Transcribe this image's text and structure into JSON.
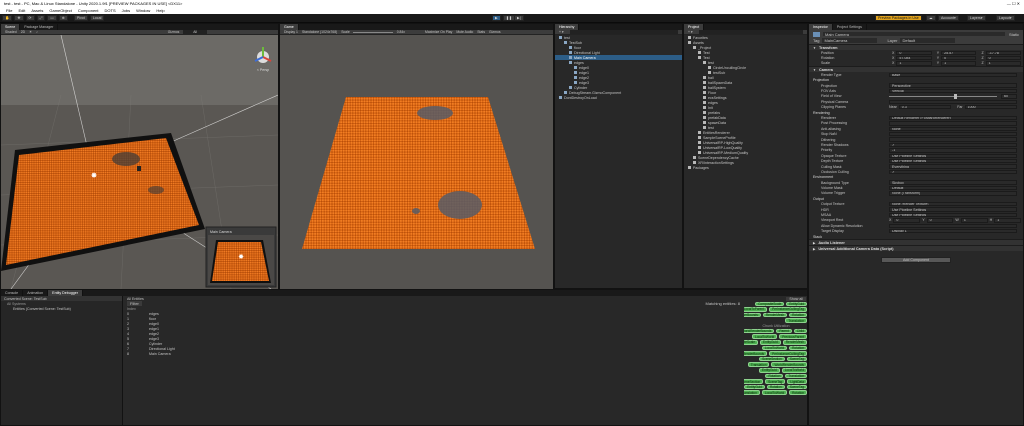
{
  "title_bar": "test - test - PC, Mac & Linux Standalone - Unity 2020.1.9f1 [PREVIEW PACKAGES IN USE] <DX11>",
  "menu": [
    "File",
    "Edit",
    "Assets",
    "GameObject",
    "Component",
    "DOTS",
    "Jobs",
    "Window",
    "Help"
  ],
  "toolbar": {
    "pivot": "Pivot",
    "local": "Local",
    "preview_packages": "Preview Packages in Use",
    "account": "Account",
    "layers": "Layers",
    "layout": "Layout"
  },
  "scene_view": {
    "tabs": [
      "Scene",
      "Package Manager"
    ],
    "shading": "Shaded",
    "mode_2d": "2D",
    "gizmos": "Gizmos",
    "search_placeholder": "All",
    "persp": "< Persp",
    "cam_preview_title": "Main Camera"
  },
  "game_view": {
    "tab": "Game",
    "display": "Display 1",
    "resolution": "Standalone (1024x768)",
    "scale_label": "Scale",
    "scale_value": "0.84x",
    "maximize": "Maximize On Play",
    "mute": "Mute Audio",
    "stats": "Stats",
    "gizmos": "Gizmos"
  },
  "hierarchy": {
    "tab": "Hierarchy",
    "items": [
      {
        "label": "test",
        "depth": 0
      },
      {
        "label": "TestSub",
        "depth": 1
      },
      {
        "label": "floor",
        "depth": 2
      },
      {
        "label": "Directional Light",
        "depth": 2
      },
      {
        "label": "Main Camera",
        "depth": 2,
        "selected": true
      },
      {
        "label": "edges",
        "depth": 2
      },
      {
        "label": "edge0",
        "depth": 3
      },
      {
        "label": "edge1",
        "depth": 3
      },
      {
        "label": "edge2",
        "depth": 3
      },
      {
        "label": "edge3",
        "depth": 3
      },
      {
        "label": "Cylinder",
        "depth": 2
      },
      {
        "label": "DebugStream.GizmoComponent",
        "depth": 1
      },
      {
        "label": "DontDestroyOnLoad",
        "depth": 0
      }
    ]
  },
  "project": {
    "tab": "Project",
    "items": [
      {
        "label": "Favorites",
        "depth": 0
      },
      {
        "label": "Assets",
        "depth": 0
      },
      {
        "label": "_Project",
        "depth": 1
      },
      {
        "label": "Test",
        "depth": 2
      },
      {
        "label": "Test",
        "depth": 2
      },
      {
        "label": "test",
        "depth": 3
      },
      {
        "label": "CircleUncullingCircle",
        "depth": 4
      },
      {
        "label": "testSub",
        "depth": 4
      },
      {
        "label": "ball",
        "depth": 3
      },
      {
        "label": "ballSpawnData",
        "depth": 3
      },
      {
        "label": "ballSystem",
        "depth": 3
      },
      {
        "label": "Floor",
        "depth": 3
      },
      {
        "label": "ecsSettings",
        "depth": 3
      },
      {
        "label": "edges",
        "depth": 3
      },
      {
        "label": "Init",
        "depth": 3
      },
      {
        "label": "prefabs",
        "depth": 3
      },
      {
        "label": "prefabData",
        "depth": 3
      },
      {
        "label": "spawnData",
        "depth": 3
      },
      {
        "label": "test",
        "depth": 3
      },
      {
        "label": "EntitiesRenderer",
        "depth": 2
      },
      {
        "label": "SampleSceneProfile",
        "depth": 2
      },
      {
        "label": "UniversalRP-HighQuality",
        "depth": 2
      },
      {
        "label": "UniversalRP-LowQuality",
        "depth": 2
      },
      {
        "label": "UniversalRP-MediumQuality",
        "depth": 2
      },
      {
        "label": "SceneDependencyCache",
        "depth": 1
      },
      {
        "label": "XR/InteractionSettings",
        "depth": 1
      },
      {
        "label": "Packages",
        "depth": 0
      }
    ]
  },
  "inspector": {
    "tabs": [
      "Inspector",
      "Project Settings"
    ],
    "object_name": "Main Camera",
    "static_label": "Static",
    "tag_label": "Tag",
    "tag_value": "MainCamera",
    "layer_label": "Layer",
    "layer_value": "Default",
    "transform": {
      "title": "Transform",
      "position": {
        "label": "Position",
        "x": "0",
        "y": "25.57",
        "z": "-17.78"
      },
      "rotation": {
        "label": "Rotation",
        "x": "57.084",
        "y": "0",
        "z": "0"
      },
      "scale": {
        "label": "Scale",
        "x": "1",
        "y": "1",
        "z": "1"
      }
    },
    "camera": {
      "title": "Camera",
      "render_type": {
        "label": "Render Type",
        "value": "Base"
      },
      "projection_header": "Projection",
      "projection": {
        "label": "Projection",
        "value": "Perspective"
      },
      "fov_axis": {
        "label": "FOV Axis",
        "value": "Vertical"
      },
      "fov": {
        "label": "Field of View",
        "value": "60"
      },
      "physical": {
        "label": "Physical Camera",
        "value": ""
      },
      "clipping": {
        "label": "Clipping Planes",
        "near_label": "Near",
        "near": "0.3",
        "far_label": "Far",
        "far": "1000"
      },
      "rendering_header": "Rendering",
      "renderer": {
        "label": "Renderer",
        "value": "Default Renderer (ForwardRenderer)"
      },
      "post": {
        "label": "Post Processing",
        "value": ""
      },
      "aa": {
        "label": "Anti-aliasing",
        "value": "None"
      },
      "stop_nan": {
        "label": "Stop NaN",
        "value": ""
      },
      "dithering": {
        "label": "Dithering",
        "value": ""
      },
      "shadows": {
        "label": "Render Shadows",
        "value": "✓"
      },
      "priority": {
        "label": "Priority",
        "value": "-1"
      },
      "opaque": {
        "label": "Opaque Texture",
        "value": "Use Pipeline Settings"
      },
      "depth": {
        "label": "Depth Texture",
        "value": "Use Pipeline Settings"
      },
      "culling": {
        "label": "Culling Mask",
        "value": "Everything"
      },
      "occlusion": {
        "label": "Occlusion Culling",
        "value": "✓"
      },
      "env_header": "Environment",
      "bg_type": {
        "label": "Background Type",
        "value": "Skybox"
      },
      "volume_mask": {
        "label": "Volume Mask",
        "value": "Default"
      },
      "volume_trigger": {
        "label": "Volume Trigger",
        "value": "None (Transform)"
      },
      "output_header": "Output",
      "output_target": {
        "label": "Output Texture",
        "value": "None (Render Texture)"
      },
      "hdr": {
        "label": "HDR",
        "value": "Use Pipeline Settings"
      },
      "msaa": {
        "label": "MSAA",
        "value": "Use Pipeline Settings"
      },
      "viewport": {
        "label": "Viewport Rect",
        "x": "0",
        "y": "0",
        "w": "1",
        "h": "1"
      },
      "dyn_res": {
        "label": "Allow Dynamic Resolution",
        "value": ""
      },
      "target_display": {
        "label": "Target Display",
        "value": "Display 1"
      },
      "stack_header": "Stack"
    },
    "audio_listener": "Audio Listener",
    "additional_data": "Universal Additional Camera Data (Script)",
    "add_component": "Add Component"
  },
  "console_area": {
    "tabs": [
      "Console",
      "Animation",
      "Entity Debugger"
    ],
    "world": "Converted Scene: TestSub",
    "systems_header": "All Systems",
    "systems_row": "Entities (Converted Scene: TestSub)",
    "entities_title": "All Entities",
    "filter": "Filter",
    "matching": "Matching entities: 8",
    "show_all": "Show all",
    "columns": [
      "Index"
    ],
    "entities": [
      {
        "index": "0",
        "name": "edges"
      },
      {
        "index": "1",
        "name": "floor"
      },
      {
        "index": "2",
        "name": "edge0"
      },
      {
        "index": "3",
        "name": "edge1"
      },
      {
        "index": "4",
        "name": "edge2"
      },
      {
        "index": "5",
        "name": "edge3"
      },
      {
        "index": "6",
        "name": "Cylinder"
      },
      {
        "index": "7",
        "name": "Directional Light"
      },
      {
        "index": "8",
        "name": "Main Camera"
      }
    ],
    "chunk_info": "Chunk Utilization",
    "tags": [
      [
        "CompositeScale",
        "EntityGuid"
      ],
      [
        "LocalToParent",
        "PerInstanceCullingTag"
      ],
      [
        "RenderBounds",
        "RenderMesh",
        "Rotation"
      ],
      [
        "Translation"
      ],
      [
        "WorldRenderBounds",
        "Parent",
        "Child"
      ],
      [
        "LocalToWorld",
        "PreviousParent"
      ],
      [
        "CompositeScale",
        "EntityGuid",
        "RenderMesh"
      ],
      [
        "LocalToWorld",
        "Rotation"
      ],
      [
        "RenderBounds",
        "PerInstanceCullingTag"
      ],
      [
        "SceneSection",
        "SceneTag"
      ],
      [
        "Translation",
        "WorldRenderBounds"
      ],
      [
        "EntityGuid",
        "LocalToWorld"
      ],
      [
        "Rotation",
        "Translation"
      ],
      [
        "SceneSection",
        "SceneTag",
        "LightData"
      ],
      [
        "EntityGuid",
        "Rotation",
        "SceneTag"
      ],
      [
        "Translation",
        "LocalToWorld",
        "Rotation"
      ]
    ]
  },
  "colors": {
    "floor": "#e4650f",
    "selection": "#2c5d87",
    "tag": "#4caf50"
  }
}
